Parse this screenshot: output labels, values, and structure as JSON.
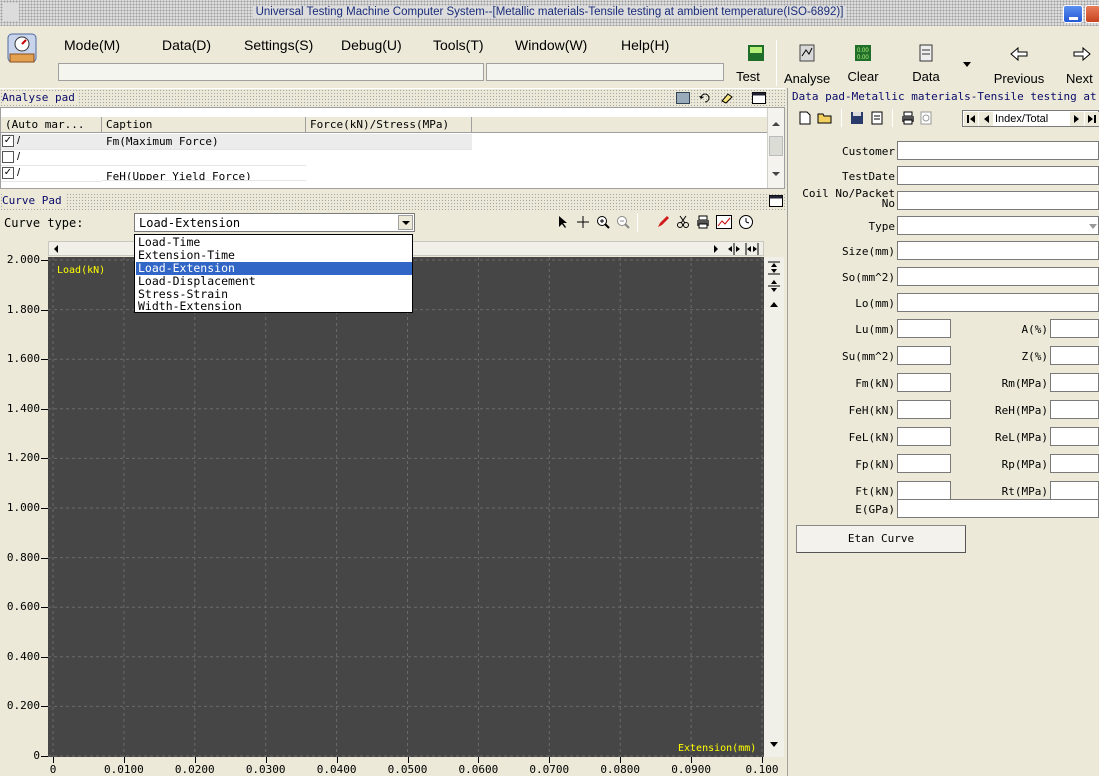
{
  "window": {
    "title": "Universal Testing Machine Computer System--[Metallic materials-Tensile testing at ambient temperature(ISO-6892)]"
  },
  "menu": {
    "items": [
      "Mode(M)",
      "Data(D)",
      "Settings(S)",
      "Debug(U)",
      "Tools(T)",
      "Window(W)",
      "Help(H)"
    ]
  },
  "toolbar": {
    "test": "Test",
    "analyse": "Analyse",
    "clear": "Clear",
    "data": "Data",
    "previous": "Previous",
    "next": "Next"
  },
  "analyse_pad": {
    "title": "Analyse pad",
    "columns": [
      "(Auto mar...",
      "Caption",
      "Force(kN)/Stress(MPa)"
    ],
    "rows": [
      {
        "checked": true,
        "mark": "/",
        "caption": "Fm(Maximum Force)"
      },
      {
        "checked": false,
        "mark": "/",
        "caption": ""
      },
      {
        "checked": true,
        "mark": "/",
        "caption": "FeH(Upper Yield Force)"
      }
    ]
  },
  "curve_pad": {
    "title": "Curve Pad",
    "curve_type_label": "Curve type:",
    "selected": "Load-Extension",
    "options": [
      "Load-Time",
      "Extension-Time",
      "Load-Extension",
      "Load-Displacement",
      "Stress-Strain",
      "Width-Extension"
    ],
    "selected_index": 2
  },
  "chart_data": {
    "type": "line",
    "ylabel": "Load(kN)",
    "xlabel": "Extension(mm)",
    "y_ticks": [
      "2.000",
      "1.800",
      "1.600",
      "1.400",
      "1.200",
      "1.000",
      "0.800",
      "0.600",
      "0.400",
      "0.200",
      "0"
    ],
    "x_ticks": [
      "0",
      "0.0100",
      "0.0200",
      "0.0300",
      "0.0400",
      "0.0500",
      "0.0600",
      "0.0700",
      "0.0800",
      "0.0900",
      "0.100"
    ],
    "ylim": [
      0,
      2.0
    ],
    "xlim": [
      0,
      0.1
    ],
    "grid": true,
    "background": "#464646",
    "label_color": "#ffff00",
    "series": []
  },
  "data_pad": {
    "title": "Data pad-Metallic materials-Tensile testing at",
    "nav_label": "Index/Total",
    "fields_full": [
      {
        "label": "Customer"
      },
      {
        "label": "TestDate"
      },
      {
        "label": "Coil No/Packet No"
      },
      {
        "label": "Type"
      },
      {
        "label": "Size(mm)"
      },
      {
        "label": "So(mm^2)"
      },
      {
        "label": "Lo(mm)"
      }
    ],
    "fields_left": [
      "Lu(mm)",
      "Su(mm^2)",
      "Fm(kN)",
      "FeH(kN)",
      "FeL(kN)",
      "Fp(kN)",
      "Ft(kN)"
    ],
    "fields_right": [
      "A(%)",
      "Z(%)",
      "Rm(MPa)",
      "ReH(MPa)",
      "ReL(MPa)",
      "Rp(MPa)",
      "Rt(MPa)"
    ],
    "e_label": "E(GPa)",
    "etan_button": "Etan Curve"
  }
}
